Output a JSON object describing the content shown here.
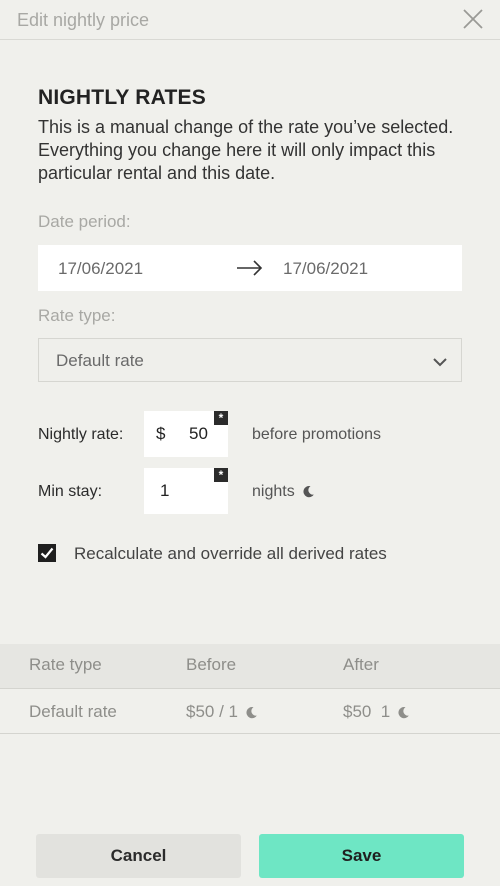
{
  "header": {
    "title": "Edit nightly price",
    "close_icon": "close-icon"
  },
  "section": {
    "title": "NIGHTLY RATES",
    "description": "This is a manual change of the rate you’ve selected. Everything you change here it will only impact this particular rental and this date."
  },
  "date_period": {
    "label": "Date period:",
    "from": "17/06/2021",
    "to": "17/06/2021",
    "arrow_icon": "arrow-right-icon"
  },
  "rate_type": {
    "label": "Rate type:",
    "selected": "Default rate",
    "chevron_icon": "chevron-down-icon"
  },
  "nightly_rate": {
    "label": "Nightly rate:",
    "currency": "$",
    "value": "50",
    "required_mark": "*",
    "suffix": "before promotions"
  },
  "min_stay": {
    "label": "Min stay:",
    "value": "1",
    "required_mark": "*",
    "suffix": "nights",
    "suffix_icon": "moon-icon"
  },
  "recalculate": {
    "checked": true,
    "label": "Recalculate and override all derived rates"
  },
  "table": {
    "headers": [
      "Rate type",
      "Before",
      "After"
    ],
    "rows": [
      {
        "rate_type": "Default rate",
        "before": "$50 / 1",
        "after": "$50  1"
      }
    ]
  },
  "footer": {
    "cancel_label": "Cancel",
    "save_label": "Save"
  },
  "colors": {
    "background": "#f0f0ec",
    "save_button": "#6ee6c4",
    "cancel_button": "#e2e2de",
    "checkbox": "#1f1f1f"
  }
}
